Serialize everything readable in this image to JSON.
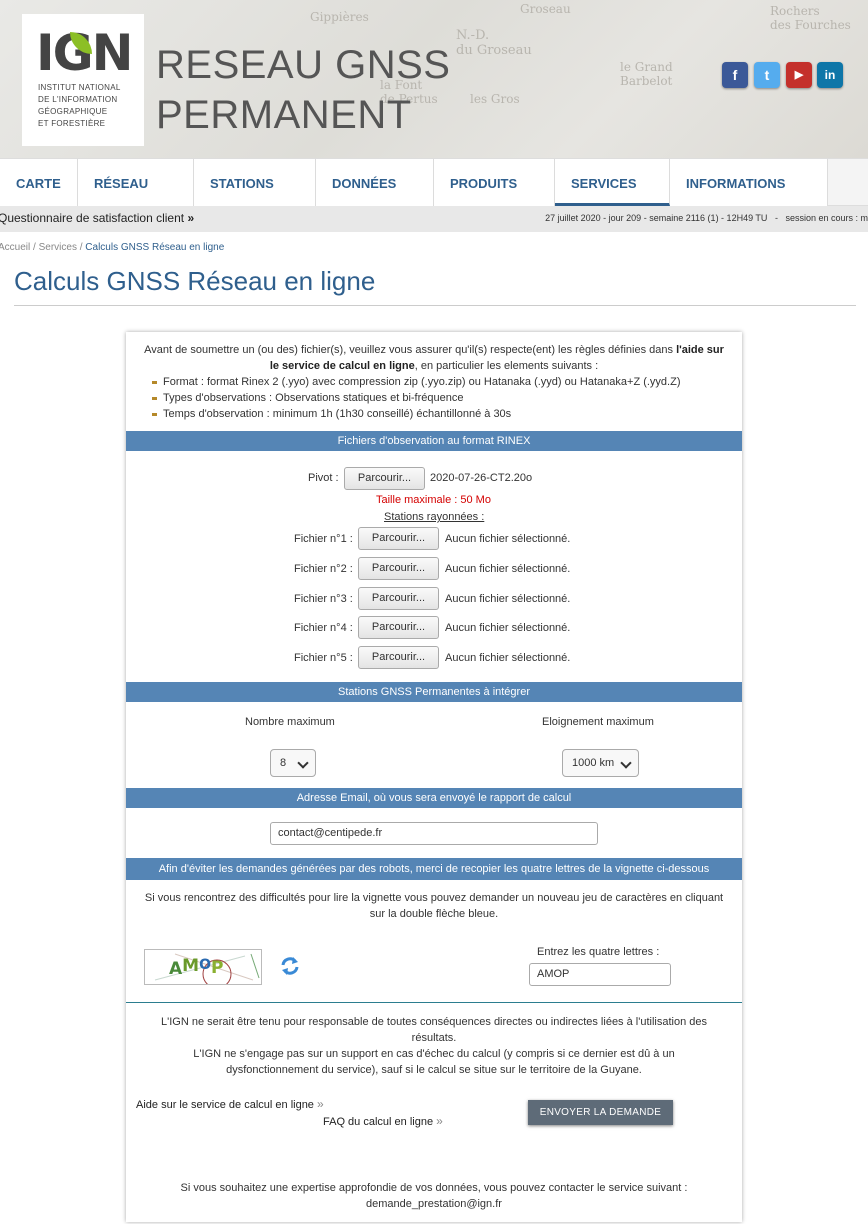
{
  "header": {
    "logo_text": "IGN",
    "logo_sub": [
      "INSTITUT NATIONAL",
      "DE L'INFORMATION",
      "GÉOGRAPHIQUE",
      "ET FORESTIÈRE"
    ],
    "title_line1": "RESEAU GNSS",
    "title_line2": "PERMANENT",
    "social": [
      {
        "name": "facebook-icon",
        "glyph": "f",
        "color": "#3b5998"
      },
      {
        "name": "twitter-icon",
        "glyph": "t",
        "color": "#55acee"
      },
      {
        "name": "youtube-icon",
        "glyph": "▶",
        "color": "#c4302b"
      },
      {
        "name": "linkedin-icon",
        "glyph": "in",
        "color": "#0e76a8"
      }
    ]
  },
  "nav": [
    "CARTE",
    "RÉSEAU",
    "STATIONS",
    "DONNÉES",
    "PRODUITS",
    "SERVICES",
    "INFORMATIONS"
  ],
  "nav_active": "SERVICES",
  "subbar": {
    "survey": "Questionnaire de satisfaction client",
    "survey_arrow": "»",
    "date": "27 juillet 2020 - jour 209 - semaine 2116 (1) - 12H49 TU",
    "sep": "-",
    "session": "session en cours : m"
  },
  "breadcrumb": {
    "home": "Accueil",
    "sep": " / ",
    "services": "Services",
    "current": "Calculs GNSS Réseau en ligne"
  },
  "page_title": "Calculs GNSS Réseau en ligne",
  "intro": {
    "text_before": "Avant de soumettre un (ou des) fichier(s), veuillez vous assurer qu'il(s) respecte(ent) les règles définies dans ",
    "link": "l'aide sur le service de calcul en ligne",
    "text_after": ", en particulier les elements suivants :",
    "bullets": [
      "Format : format Rinex 2 (.yyo) avec compression zip (.yyo.zip) ou Hatanaka (.yyd) ou Hatanaka+Z (.yyd.Z)",
      "Types d'observations : Observations statiques et bi-fréquence",
      "Temps d'observation : minimum 1h (1h30 conseillé) échantillonné à 30s"
    ]
  },
  "rinex": {
    "band": "Fichiers d'observation au format RINEX",
    "pivot_label": "Pivot :",
    "browse": "Parcourir...",
    "pivot_file": "2020-07-26-CT2.20o",
    "max_size": "Taille maximale : 50 Mo",
    "stations_label": "Stations rayonnées :",
    "files": [
      {
        "label": "Fichier n°1 :",
        "value": "Aucun fichier sélectionné."
      },
      {
        "label": "Fichier n°2 :",
        "value": "Aucun fichier sélectionné."
      },
      {
        "label": "Fichier n°3 :",
        "value": "Aucun fichier sélectionné."
      },
      {
        "label": "Fichier n°4 :",
        "value": "Aucun fichier sélectionné."
      },
      {
        "label": "Fichier n°5 :",
        "value": "Aucun fichier sélectionné."
      }
    ]
  },
  "stations": {
    "band": "Stations GNSS Permanentes à intégrer",
    "max_label": "Nombre maximum",
    "max_value": "8",
    "dist_label": "Eloignement maximum",
    "dist_value": "1000 km"
  },
  "email": {
    "band": "Adresse Email, où vous sera envoyé le rapport de calcul",
    "value": "contact@centipede.fr"
  },
  "captcha": {
    "band": "Afin d'éviter les demandes générées par des robots, merci de recopier les quatre lettres de la vignette ci-dessous",
    "help": "Si vous rencontrez des difficultés pour lire la vignette vous pouvez demander un nouveau jeu de caractères en cliquant sur la double flèche bleue.",
    "image_text": "AMOP",
    "input_label": "Entrez les quatre lettres :",
    "input_value": "AMOP"
  },
  "disclaimer": [
    "L'IGN ne serait être tenu pour responsable de toutes conséquences directes ou indirectes liées à l'utilisation des résultats.",
    "L'IGN ne s'engage pas sur un support en cas d'échec du calcul (y compris si ce dernier est dû à un dysfonctionnement du service), sauf si le calcul se situe sur le territoire de la Guyane."
  ],
  "links": {
    "help": "Aide sur le service de calcul en ligne",
    "faq": "FAQ du calcul en ligne",
    "arrow": "»"
  },
  "send_button": "ENVOYER LA DEMANDE",
  "footer": {
    "text": "Si vous souhaitez une expertise approfondie de vos données, vous pouvez contacter le service suivant :",
    "email": "demande_prestation@ign.fr"
  }
}
